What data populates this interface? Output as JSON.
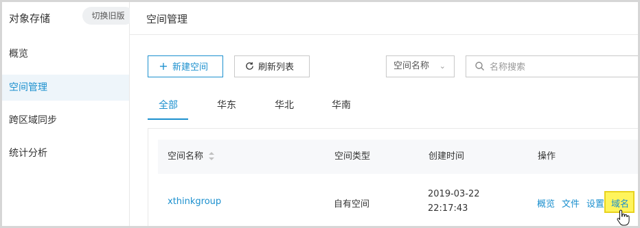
{
  "sidebar": {
    "title": "对象存储",
    "switch_label": "切换旧版",
    "items": [
      {
        "label": "概览"
      },
      {
        "label": "空间管理"
      },
      {
        "label": "跨区域同步"
      },
      {
        "label": "统计分析"
      }
    ]
  },
  "header": {
    "title": "空间管理"
  },
  "toolbar": {
    "new_label": "新建空间",
    "refresh_label": "刷新列表",
    "select_value": "空间名称",
    "search_placeholder": "名称搜索"
  },
  "tabs": [
    {
      "label": "全部"
    },
    {
      "label": "华东"
    },
    {
      "label": "华北"
    },
    {
      "label": "华南"
    }
  ],
  "table": {
    "columns": [
      "空间名称",
      "空间类型",
      "创建时间",
      "操作"
    ],
    "rows": [
      {
        "name": "xthinkgroup",
        "type": "自有空间",
        "created_date": "2019-03-22",
        "created_time": "22:17:43",
        "actions": [
          "概览",
          "文件",
          "设置",
          "域名"
        ]
      }
    ]
  },
  "colors": {
    "accent": "#1a8fce",
    "highlight": "#fff45c"
  }
}
